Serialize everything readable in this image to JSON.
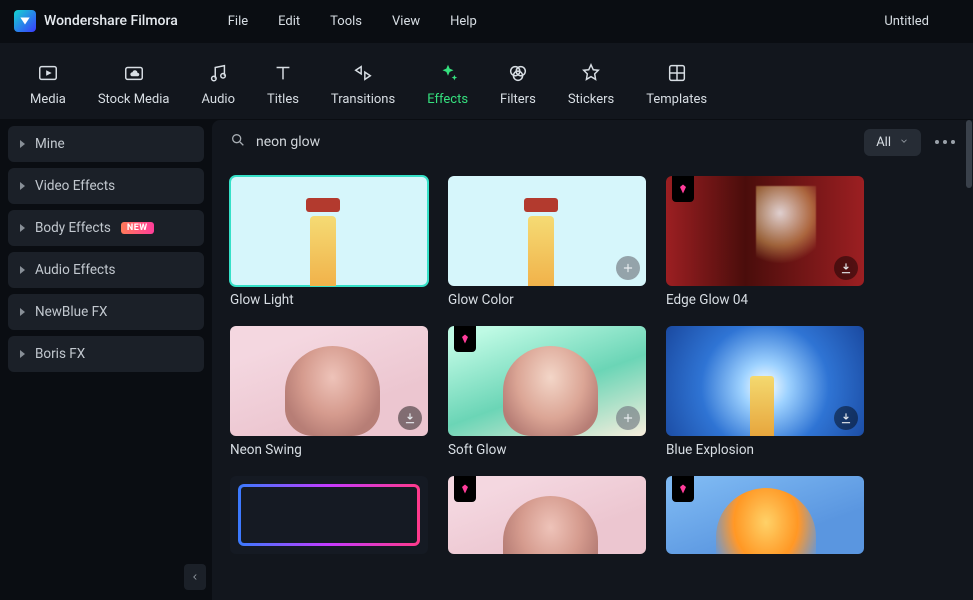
{
  "app": {
    "title": "Wondershare Filmora"
  },
  "menu": {
    "file": "File",
    "edit": "Edit",
    "tools": "Tools",
    "view": "View",
    "help": "Help"
  },
  "document": {
    "title": "Untitled"
  },
  "toolbar": {
    "media": "Media",
    "stock_media": "Stock Media",
    "audio": "Audio",
    "titles": "Titles",
    "transitions": "Transitions",
    "effects": "Effects",
    "filters": "Filters",
    "stickers": "Stickers",
    "templates": "Templates"
  },
  "sidebar": {
    "items": [
      {
        "label": "Mine"
      },
      {
        "label": "Video Effects"
      },
      {
        "label": "Body Effects",
        "badge": "NEW"
      },
      {
        "label": "Audio Effects"
      },
      {
        "label": "NewBlue FX"
      },
      {
        "label": "Boris FX"
      }
    ]
  },
  "search": {
    "value": "neon glow"
  },
  "filter": {
    "all": "All"
  },
  "cards": [
    {
      "title": "Glow Light"
    },
    {
      "title": "Glow Color"
    },
    {
      "title": "Edge Glow 04"
    },
    {
      "title": "Neon Swing"
    },
    {
      "title": "Soft Glow"
    },
    {
      "title": "Blue Explosion"
    }
  ]
}
